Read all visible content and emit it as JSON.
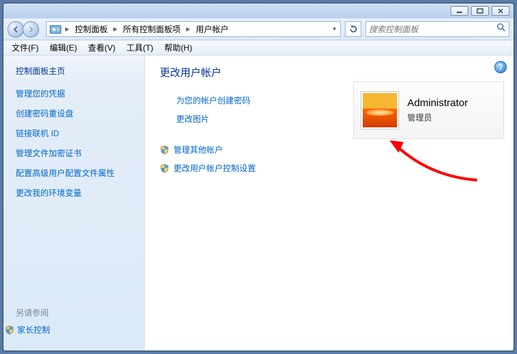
{
  "titlebar": {},
  "nav": {
    "crumbs": [
      "控制面板",
      "所有控制面板项",
      "用户帐户"
    ]
  },
  "search": {
    "placeholder": "搜索控制面板"
  },
  "menubar": {
    "items": [
      "文件(F)",
      "编辑(E)",
      "查看(V)",
      "工具(T)",
      "帮助(H)"
    ]
  },
  "sidebar": {
    "home": "控制面板主页",
    "links": [
      "管理您的凭据",
      "创建密码重设盘",
      "链接联机 ID",
      "管理文件加密证书",
      "配置高级用户配置文件属性",
      "更改我的环境变量"
    ],
    "see_also_label": "另请参阅",
    "see_also_links": [
      "家长控制"
    ]
  },
  "content": {
    "heading": "更改用户帐户",
    "primary_tasks": [
      "为您的帐户创建密码",
      "更改图片"
    ],
    "other_tasks": [
      "管理其他帐户",
      "更改用户帐户控制设置"
    ],
    "help_tooltip": "?"
  },
  "user": {
    "name": "Administrator",
    "role": "管理员"
  }
}
